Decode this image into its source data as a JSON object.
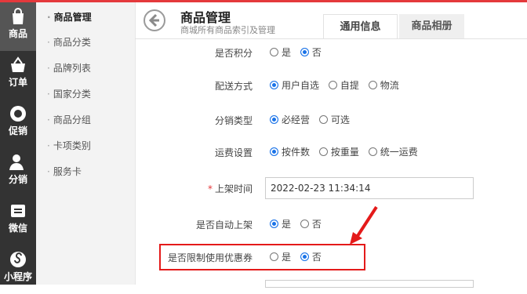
{
  "rail": {
    "items": [
      {
        "label": "商品",
        "icon": "shopping-bag-icon"
      },
      {
        "label": "订单",
        "icon": "basket-icon"
      },
      {
        "label": "促销",
        "icon": "sale-badge-icon"
      },
      {
        "label": "分销",
        "icon": "person-icon"
      },
      {
        "label": "微信",
        "icon": "wechat-icon"
      },
      {
        "label": "小程序",
        "icon": "mini-program-icon"
      }
    ]
  },
  "subnav": {
    "items": [
      "商品管理",
      "商品分类",
      "品牌列表",
      "国家分类",
      "商品分组",
      "卡项类别",
      "服务卡"
    ]
  },
  "header": {
    "title": "商品管理",
    "subtitle": "商城所有商品索引及管理",
    "tabs": [
      "通用信息",
      "商品相册"
    ]
  },
  "form": {
    "points": {
      "label": "是否积分",
      "options": [
        "是",
        "否"
      ],
      "selected": 1
    },
    "delivery": {
      "label": "配送方式",
      "options": [
        "用户自选",
        "自提",
        "物流"
      ],
      "selected": 0
    },
    "distribution": {
      "label": "分销类型",
      "options": [
        "必经营",
        "可选"
      ],
      "selected": 0
    },
    "freight": {
      "label": "运费设置",
      "options": [
        "按件数",
        "按重量",
        "统一运费"
      ],
      "selected": 0
    },
    "shelf_time": {
      "label": "上架时间",
      "value": "2022-02-23 11:34:14",
      "required": true
    },
    "auto_shelf": {
      "label": "是否自动上架",
      "options": [
        "是",
        "否"
      ],
      "selected": 0
    },
    "coupon_limit": {
      "label": "是否限制使用优惠券",
      "options": [
        "是",
        "否"
      ],
      "selected": 1
    }
  },
  "colors": {
    "accent": "#e4393c",
    "highlight": "#e41a1a",
    "radio": "#1a73e8",
    "rail": "#333333"
  }
}
